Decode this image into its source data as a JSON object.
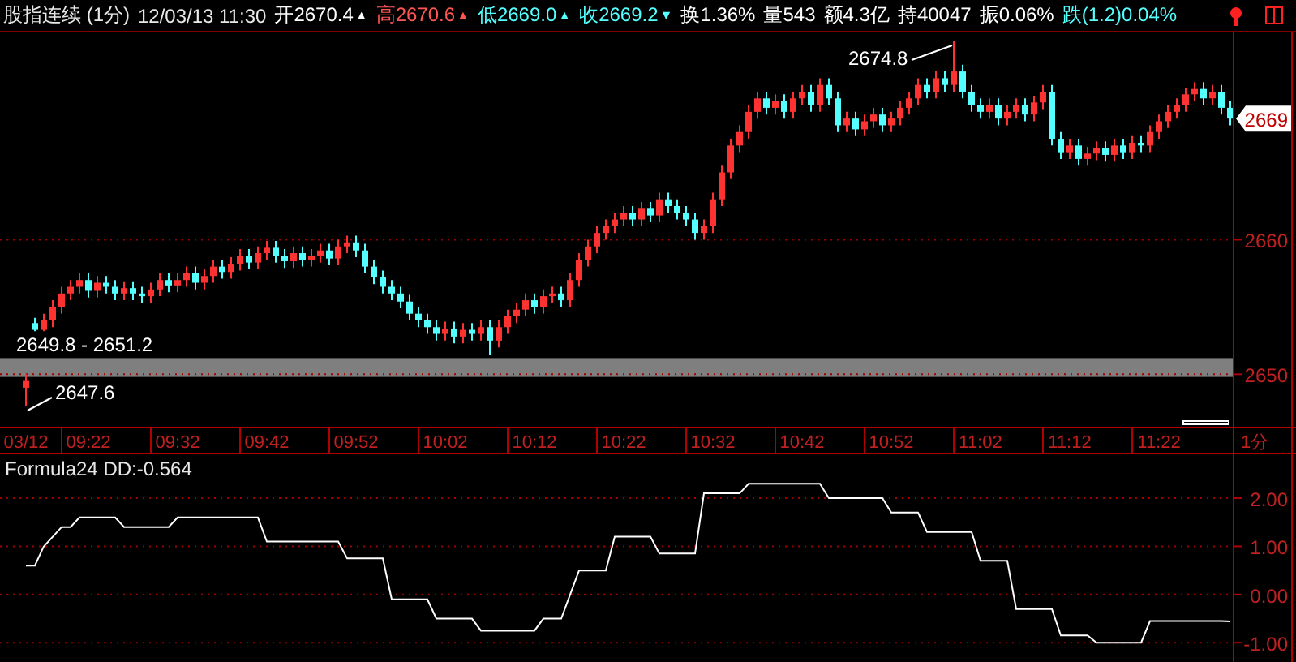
{
  "header": {
    "title": "股指连续 (1分)",
    "datetime": "12/03/13 11:30",
    "quotes": [
      {
        "text": "开2670.4",
        "color": "#ffffff",
        "arrow": "▲"
      },
      {
        "text": "高2670.6",
        "color": "#ff5555",
        "arrow": "▲"
      },
      {
        "text": "低2669.0",
        "color": "#54ffff",
        "arrow": "▲"
      },
      {
        "text": "收2669.2",
        "color": "#54ffff",
        "arrow": "▼"
      },
      {
        "text": "换1.36%",
        "color": "#ffffff"
      },
      {
        "text": "量543",
        "color": "#ffffff"
      },
      {
        "text": "额4.3亿",
        "color": "#ffffff"
      },
      {
        "text": "持40047",
        "color": "#ffffff"
      },
      {
        "text": "振0.06%",
        "color": "#ffffff"
      },
      {
        "text": "跌(1.2)0.04%",
        "color": "#54ffff"
      }
    ]
  },
  "main_chart": {
    "last_price": "2669",
    "period_label": "1分",
    "annotations": [
      {
        "text": "2674.8"
      },
      {
        "text": "2647.6"
      }
    ],
    "chart_data": {
      "type": "candlestick",
      "grid": true,
      "ylim": [
        2646.1,
        2675.4
      ],
      "yticks": [
        2650,
        2660
      ],
      "bands": [
        {
          "axis": "y",
          "from": 2649.8,
          "to": 2651.2,
          "color": "#7f7f7f",
          "label": "2649.8 - 2651.2"
        }
      ],
      "categories": [
        "03/12",
        null,
        null,
        null,
        null,
        null,
        null,
        "09:22",
        null,
        null,
        null,
        null,
        null,
        null,
        null,
        null,
        null,
        "09:32",
        null,
        null,
        null,
        null,
        null,
        null,
        null,
        null,
        null,
        "09:42",
        null,
        null,
        null,
        null,
        null,
        null,
        null,
        null,
        null,
        "09:52",
        null,
        null,
        null,
        null,
        null,
        null,
        null,
        null,
        null,
        "10:02",
        null,
        null,
        null,
        null,
        null,
        null,
        null,
        null,
        null,
        "10:12",
        null,
        null,
        null,
        null,
        null,
        null,
        null,
        null,
        null,
        "10:22",
        null,
        null,
        null,
        null,
        null,
        null,
        null,
        null,
        null,
        "10:32",
        null,
        null,
        null,
        null,
        null,
        null,
        null,
        null,
        null,
        "10:42",
        null,
        null,
        null,
        null,
        null,
        null,
        null,
        null,
        null,
        "10:52",
        null,
        null,
        null,
        null,
        null,
        null,
        null,
        null,
        null,
        "11:02",
        null,
        null,
        null,
        null,
        null,
        null,
        null,
        null,
        null,
        "11:12",
        null,
        null,
        null,
        null,
        null,
        null,
        null,
        null,
        null,
        "11:22",
        null,
        null,
        null,
        null,
        null,
        null,
        null,
        null
      ],
      "series": [
        {
          "ohlc": [
            [
              2649,
              2650,
              2647.6,
              2649.5
            ],
            [
              2653.8,
              2654.2,
              2653.2,
              2653.3
            ],
            [
              2653.3,
              2654.5,
              2653.2,
              2654
            ],
            [
              2654,
              2655.5,
              2653.5,
              2655
            ],
            [
              2655,
              2656.5,
              2654.5,
              2656
            ],
            [
              2656,
              2657,
              2655.5,
              2656.5
            ],
            [
              2656.5,
              2657.5,
              2656,
              2657
            ],
            [
              2657,
              2657.5,
              2655.7,
              2656.2
            ],
            [
              2656.2,
              2657.3,
              2655.7,
              2656.8
            ],
            [
              2656.8,
              2657.3,
              2656,
              2656.5
            ],
            [
              2656.5,
              2657,
              2655.5,
              2656
            ],
            [
              2656,
              2656.9,
              2655.5,
              2656.4
            ],
            [
              2656.4,
              2656.9,
              2655.5,
              2656
            ],
            [
              2656,
              2656.5,
              2655.3,
              2655.8
            ],
            [
              2655.8,
              2656.8,
              2655.3,
              2656.3
            ],
            [
              2656.3,
              2657.5,
              2655.8,
              2657
            ],
            [
              2657,
              2657.5,
              2656.1,
              2656.6
            ],
            [
              2656.6,
              2657.5,
              2656.1,
              2657
            ],
            [
              2657,
              2658,
              2656.5,
              2657.5
            ],
            [
              2657.5,
              2658,
              2656.3,
              2656.8
            ],
            [
              2656.8,
              2657.8,
              2656.3,
              2657.3
            ],
            [
              2657.3,
              2658.5,
              2656.8,
              2658
            ],
            [
              2658,
              2658.5,
              2657.1,
              2657.6
            ],
            [
              2657.6,
              2658.7,
              2657.1,
              2658.2
            ],
            [
              2658.2,
              2659.3,
              2657.7,
              2658.8
            ],
            [
              2658.8,
              2659.3,
              2657.8,
              2658.3
            ],
            [
              2658.3,
              2659.5,
              2657.8,
              2659
            ],
            [
              2659,
              2659.9,
              2658.5,
              2659.4
            ],
            [
              2659.4,
              2659.9,
              2658.3,
              2658.8
            ],
            [
              2658.8,
              2659.3,
              2657.9,
              2658.4
            ],
            [
              2658.4,
              2659.5,
              2657.9,
              2659
            ],
            [
              2659,
              2659.5,
              2658,
              2658.5
            ],
            [
              2658.5,
              2659.3,
              2658,
              2658.8
            ],
            [
              2658.8,
              2659.7,
              2658.3,
              2659.2
            ],
            [
              2659.2,
              2659.7,
              2658.1,
              2658.6
            ],
            [
              2658.6,
              2660,
              2658.1,
              2659.5
            ],
            [
              2659.5,
              2660.3,
              2659,
              2659.8
            ],
            [
              2659.8,
              2660.3,
              2658.7,
              2659.2
            ],
            [
              2659.2,
              2659.7,
              2657.5,
              2658
            ],
            [
              2658,
              2658.5,
              2656.7,
              2657.2
            ],
            [
              2657.2,
              2657.7,
              2656,
              2656.5
            ],
            [
              2656.5,
              2657,
              2655.5,
              2656
            ],
            [
              2656,
              2656.5,
              2654.9,
              2655.4
            ],
            [
              2655.4,
              2655.9,
              2654,
              2654.5
            ],
            [
              2654.5,
              2655,
              2653.5,
              2654
            ],
            [
              2654,
              2654.5,
              2653,
              2653.5
            ],
            [
              2653.5,
              2654,
              2652.5,
              2653
            ],
            [
              2653,
              2653.9,
              2652.5,
              2653.4
            ],
            [
              2653.4,
              2653.9,
              2652.3,
              2652.8
            ],
            [
              2652.8,
              2653.8,
              2652.3,
              2653.3
            ],
            [
              2653.3,
              2653.8,
              2652.5,
              2653
            ],
            [
              2653,
              2654,
              2652.5,
              2653.5
            ],
            [
              2653.5,
              2654,
              2651.4,
              2652.5
            ],
            [
              2652.5,
              2654,
              2652,
              2653.5
            ],
            [
              2653.5,
              2654.8,
              2653,
              2654.3
            ],
            [
              2654.3,
              2655.3,
              2653.8,
              2654.8
            ],
            [
              2654.8,
              2656,
              2654.3,
              2655.5
            ],
            [
              2655.5,
              2656,
              2654.5,
              2655
            ],
            [
              2655,
              2656.3,
              2654.5,
              2655.8
            ],
            [
              2655.8,
              2656.5,
              2655.3,
              2656
            ],
            [
              2656,
              2656.5,
              2655,
              2655.5
            ],
            [
              2655.5,
              2657.5,
              2655,
              2657
            ],
            [
              2657,
              2659,
              2656.5,
              2658.5
            ],
            [
              2658.5,
              2660,
              2658,
              2659.5
            ],
            [
              2659.5,
              2661,
              2659,
              2660.5
            ],
            [
              2660.5,
              2661.5,
              2660,
              2661
            ],
            [
              2661,
              2662,
              2660.5,
              2661.5
            ],
            [
              2661.5,
              2662.5,
              2661,
              2662
            ],
            [
              2662,
              2662.5,
              2661,
              2661.5
            ],
            [
              2661.5,
              2662.8,
              2661,
              2662.3
            ],
            [
              2662.3,
              2662.8,
              2661.3,
              2661.8
            ],
            [
              2661.8,
              2663.5,
              2661.3,
              2663
            ],
            [
              2663,
              2663.5,
              2662,
              2662.5
            ],
            [
              2662.5,
              2663,
              2661.5,
              2662
            ],
            [
              2662,
              2662.5,
              2661,
              2661.5
            ],
            [
              2661.5,
              2662,
              2660,
              2660.5
            ],
            [
              2660.5,
              2661.5,
              2660,
              2661
            ],
            [
              2661,
              2663.5,
              2660.5,
              2663
            ],
            [
              2663,
              2665.5,
              2662.5,
              2665
            ],
            [
              2665,
              2667.5,
              2664.5,
              2667
            ],
            [
              2667,
              2668.5,
              2666.5,
              2668
            ],
            [
              2668,
              2670,
              2667.5,
              2669.5
            ],
            [
              2669.5,
              2671,
              2669,
              2670.5
            ],
            [
              2670.5,
              2671,
              2669.3,
              2669.8
            ],
            [
              2669.8,
              2670.8,
              2669.3,
              2670.3
            ],
            [
              2670.3,
              2670.8,
              2669,
              2669.5
            ],
            [
              2669.5,
              2671,
              2669,
              2670.5
            ],
            [
              2670.5,
              2671.5,
              2670,
              2671
            ],
            [
              2671,
              2671.5,
              2669.5,
              2670
            ],
            [
              2670,
              2672,
              2669.5,
              2671.5
            ],
            [
              2671.5,
              2672,
              2670,
              2670.5
            ],
            [
              2670.5,
              2671,
              2668,
              2668.5
            ],
            [
              2668.5,
              2669.5,
              2668,
              2669
            ],
            [
              2669,
              2669.5,
              2667.7,
              2668.2
            ],
            [
              2668.2,
              2669.3,
              2667.7,
              2668.8
            ],
            [
              2668.8,
              2669.8,
              2668.3,
              2669.3
            ],
            [
              2669.3,
              2669.8,
              2668,
              2668.5
            ],
            [
              2668.5,
              2669.5,
              2668,
              2669
            ],
            [
              2669,
              2670.3,
              2668.5,
              2669.8
            ],
            [
              2669.8,
              2671,
              2669.3,
              2670.5
            ],
            [
              2670.5,
              2672,
              2670,
              2671.5
            ],
            [
              2671.5,
              2672,
              2670.5,
              2671
            ],
            [
              2671,
              2672.5,
              2670.5,
              2672
            ],
            [
              2672,
              2672.5,
              2671,
              2671.5
            ],
            [
              2671.5,
              2674.8,
              2671,
              2672.5
            ],
            [
              2672.5,
              2673,
              2670.5,
              2671
            ],
            [
              2671,
              2671.5,
              2669.5,
              2670
            ],
            [
              2670,
              2670.5,
              2669,
              2669.5
            ],
            [
              2669.5,
              2670.5,
              2669,
              2670
            ],
            [
              2670,
              2670.5,
              2668.5,
              2669
            ],
            [
              2669,
              2670,
              2668.5,
              2669.5
            ],
            [
              2669.5,
              2670.5,
              2669,
              2670
            ],
            [
              2670,
              2670.5,
              2668.8,
              2669.3
            ],
            [
              2669.3,
              2670.7,
              2668.8,
              2670.2
            ],
            [
              2670.2,
              2671.5,
              2669.7,
              2671
            ],
            [
              2671,
              2671.5,
              2667,
              2667.5
            ],
            [
              2667.5,
              2668,
              2666,
              2666.5
            ],
            [
              2666.5,
              2667.5,
              2666,
              2667
            ],
            [
              2667,
              2667.5,
              2665.5,
              2666
            ],
            [
              2666,
              2666.9,
              2665.5,
              2666.4
            ],
            [
              2666.4,
              2667.3,
              2665.9,
              2666.8
            ],
            [
              2666.8,
              2667.3,
              2665.8,
              2666.3
            ],
            [
              2666.3,
              2667.5,
              2665.8,
              2667
            ],
            [
              2667,
              2667.5,
              2666,
              2666.5
            ],
            [
              2666.5,
              2667.7,
              2666,
              2667.2
            ],
            [
              2667.2,
              2667.7,
              2666.5,
              2667
            ],
            [
              2667,
              2668.5,
              2666.5,
              2668
            ],
            [
              2668,
              2669.3,
              2667.5,
              2668.8
            ],
            [
              2668.8,
              2670,
              2668.3,
              2669.5
            ],
            [
              2669.5,
              2670.5,
              2669,
              2670
            ],
            [
              2670,
              2671.3,
              2669.5,
              2670.8
            ],
            [
              2670.8,
              2671.7,
              2670.3,
              2671.2
            ],
            [
              2671.2,
              2671.7,
              2670,
              2670.5
            ],
            [
              2670.5,
              2671.5,
              2670,
              2671
            ],
            [
              2671,
              2671.5,
              2669.3,
              2669.8
            ],
            [
              2669.8,
              2670.3,
              2668.5,
              2669
            ]
          ]
        }
      ]
    }
  },
  "indicator": {
    "title": "Formula24 DD:-0.564",
    "chart_data": {
      "type": "line",
      "grid": true,
      "ylim": [
        -1.4,
        2.91
      ],
      "yticks": [
        {
          "value": 2,
          "label": "2.00"
        },
        {
          "value": 1,
          "label": "1.00"
        },
        {
          "value": 0,
          "label": "0.00"
        },
        {
          "value": -1,
          "label": "-1.00"
        }
      ],
      "series": [
        {
          "color": "#ffffff",
          "values": [
            0.6,
            0.6,
            1.0,
            1.2,
            1.4,
            1.4,
            1.6,
            1.6,
            1.6,
            1.6,
            1.6,
            1.4,
            1.4,
            1.4,
            1.4,
            1.4,
            1.4,
            1.6,
            1.6,
            1.6,
            1.6,
            1.6,
            1.6,
            1.6,
            1.6,
            1.6,
            1.6,
            1.1,
            1.1,
            1.1,
            1.1,
            1.1,
            1.1,
            1.1,
            1.1,
            1.1,
            0.75,
            0.75,
            0.75,
            0.75,
            0.75,
            -0.1,
            -0.1,
            -0.1,
            -0.1,
            -0.1,
            -0.5,
            -0.5,
            -0.5,
            -0.5,
            -0.5,
            -0.75,
            -0.75,
            -0.75,
            -0.75,
            -0.75,
            -0.75,
            -0.75,
            -0.5,
            -0.5,
            -0.5,
            0.0,
            0.5,
            0.5,
            0.5,
            0.5,
            1.2,
            1.2,
            1.2,
            1.2,
            1.2,
            0.85,
            0.85,
            0.85,
            0.85,
            0.85,
            2.1,
            2.1,
            2.1,
            2.1,
            2.1,
            2.3,
            2.3,
            2.3,
            2.3,
            2.3,
            2.3,
            2.3,
            2.3,
            2.3,
            2.0,
            2.0,
            2.0,
            2.0,
            2.0,
            2.0,
            2.0,
            1.7,
            1.7,
            1.7,
            1.7,
            1.3,
            1.3,
            1.3,
            1.3,
            1.3,
            1.3,
            0.7,
            0.7,
            0.7,
            0.7,
            -0.3,
            -0.3,
            -0.3,
            -0.3,
            -0.3,
            -0.85,
            -0.85,
            -0.85,
            -0.85,
            -1.0,
            -1.0,
            -1.0,
            -1.0,
            -1.0,
            -1.0,
            -0.55,
            -0.55,
            -0.55,
            -0.55,
            -0.55,
            -0.55,
            -0.55,
            -0.55,
            -0.55,
            -0.56
          ]
        }
      ]
    }
  }
}
